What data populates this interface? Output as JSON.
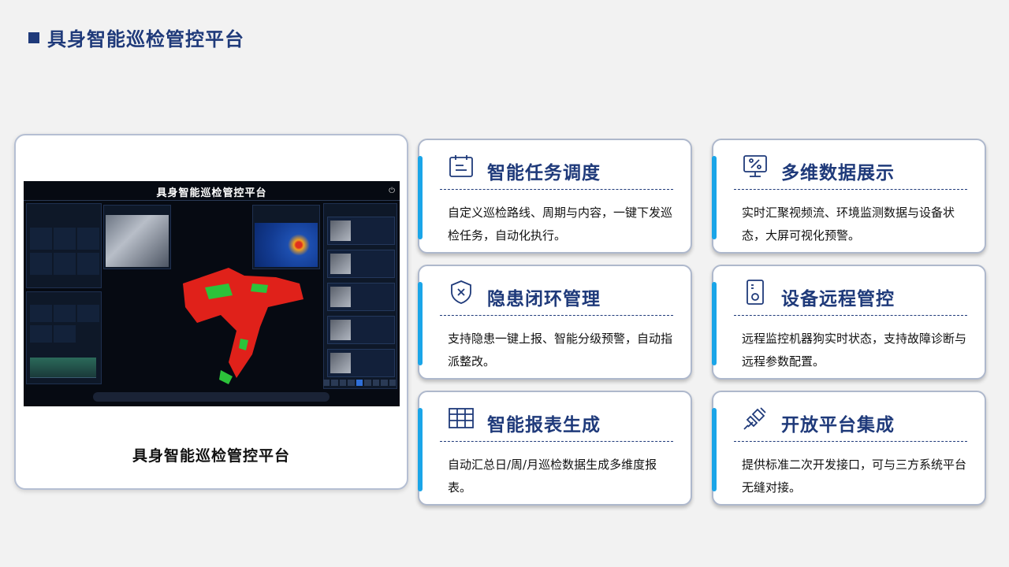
{
  "page": {
    "title": "具身智能巡检管控平台"
  },
  "showcase": {
    "screen_title": "具身智能巡检管控平台",
    "caption": "具身智能巡检管控平台"
  },
  "features": [
    {
      "icon": "calendar-icon",
      "title": "智能任务调度",
      "desc": "自定义巡检路线、周期与内容，一键下发巡检任务，自动化执行。"
    },
    {
      "icon": "monitor-percent-icon",
      "title": "多维数据展示",
      "desc": "实时汇聚视频流、环境监测数据与设备状态，大屏可视化预警。"
    },
    {
      "icon": "shield-x-icon",
      "title": "隐患闭环管理",
      "desc": "支持隐患一键上报、智能分级预警，自动指派整改。"
    },
    {
      "icon": "remote-device-icon",
      "title": "设备远程管控",
      "desc": "远程监控机器狗实时状态，支持故障诊断与远程参数配置。"
    },
    {
      "icon": "table-grid-icon",
      "title": "智能报表生成",
      "desc": "自动汇总日/周/月巡检数据生成多维度报表。"
    },
    {
      "icon": "plug-connect-icon",
      "title": "开放平台集成",
      "desc": "提供标准二次开发接口，可与三方系统平台无缝对接。"
    }
  ],
  "colors": {
    "brand": "#1f3a7a",
    "accent": "#1aa5e8"
  }
}
